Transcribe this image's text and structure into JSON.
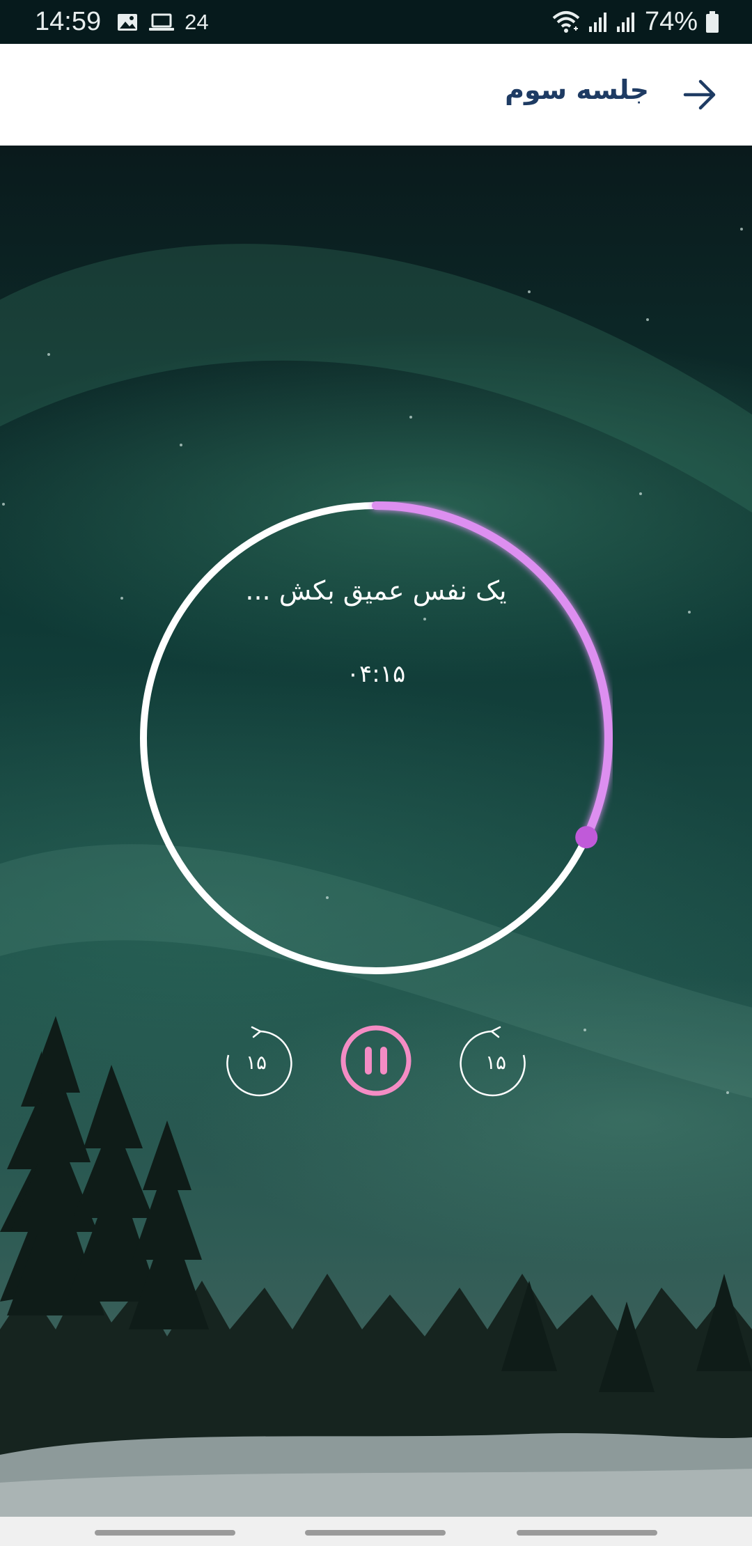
{
  "status_bar": {
    "time": "14:59",
    "notification_count": "24",
    "battery": "74%",
    "icons": [
      "image-icon",
      "laptop-icon",
      "wifi-icon",
      "signal-icon",
      "signal-icon",
      "battery-icon"
    ]
  },
  "header": {
    "title": "جلسه سوم",
    "back_icon": "arrow-right-icon"
  },
  "player": {
    "breath_text": "یک نفس عمیق بکش ...",
    "timer": "۰۴:۱۵",
    "progress": 0.32,
    "rewind_label": "۱۵",
    "forward_label": "۱۵",
    "state": "playing",
    "colors": {
      "track": "#ffffff",
      "progress": "#dd8ff0",
      "knob": "#c05ad9",
      "pause_button": "#f48cc4"
    }
  }
}
